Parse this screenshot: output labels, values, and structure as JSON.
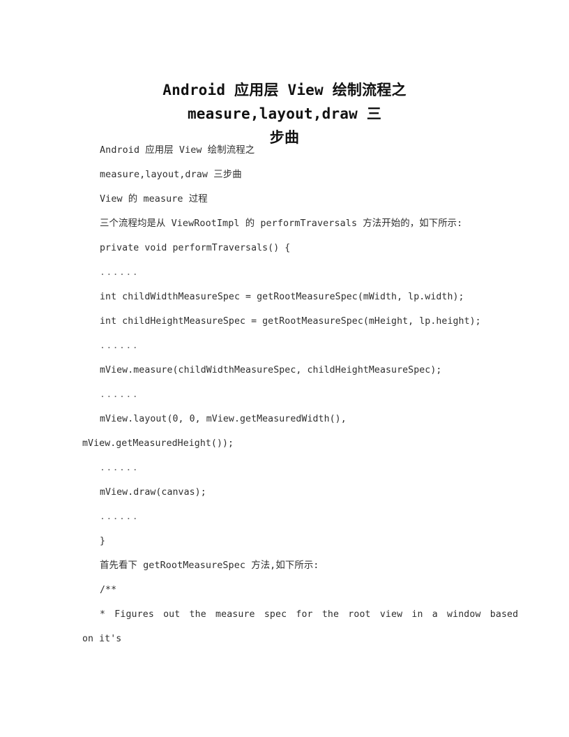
{
  "document": {
    "title_lines": [
      "Android 应用层 View 绘制流程之 measure,layout,draw 三",
      "步曲"
    ],
    "title_full": "Android 应用层 View 绘制流程之 measure,layout,draw 三步曲",
    "background_color": "#ffffff",
    "text_color": "#2e2e2e",
    "title_color": "#111111",
    "body_lines": [
      {
        "text": "Android 应用层 View 绘制流程之",
        "style": "cjk"
      },
      {
        "text": "measure,layout,draw 三步曲",
        "style": "cjk"
      },
      {
        "text": "View 的 measure 过程",
        "style": "cjk"
      },
      {
        "text": "三个流程均是从 ViewRootImpl 的 performTraversals 方法开始的，如下所示:",
        "style": "cjk"
      },
      {
        "text": "private void performTraversals() {",
        "style": "code"
      },
      {
        "text": "......",
        "style": "ellipsis"
      },
      {
        "text": "int childWidthMeasureSpec = getRootMeasureSpec(mWidth, lp.width);",
        "style": "code"
      },
      {
        "text": "int childHeightMeasureSpec = getRootMeasureSpec(mHeight, lp.height);",
        "style": "code"
      },
      {
        "text": "......",
        "style": "ellipsis"
      },
      {
        "text": "mView.measure(childWidthMeasureSpec, childHeightMeasureSpec);",
        "style": "code"
      },
      {
        "text": "......",
        "style": "ellipsis"
      },
      {
        "text": "mView.layout(0, 0, mView.getMeasuredWidth(),",
        "style": "code"
      },
      {
        "text": "mView.getMeasuredHeight());",
        "style": "code-wrapped"
      },
      {
        "text": "......",
        "style": "ellipsis"
      },
      {
        "text": "mView.draw(canvas);",
        "style": "code"
      },
      {
        "text": "......",
        "style": "ellipsis"
      },
      {
        "text": "}",
        "style": "code"
      },
      {
        "text": "首先看下 getRootMeasureSpec 方法,如下所示:",
        "style": "cjk"
      },
      {
        "text": "/**",
        "style": "code"
      },
      {
        "text": "* Figures out the measure spec for the root view in a window based",
        "style": "justified"
      },
      {
        "text": "on it's",
        "style": "code-wrapped"
      }
    ]
  }
}
